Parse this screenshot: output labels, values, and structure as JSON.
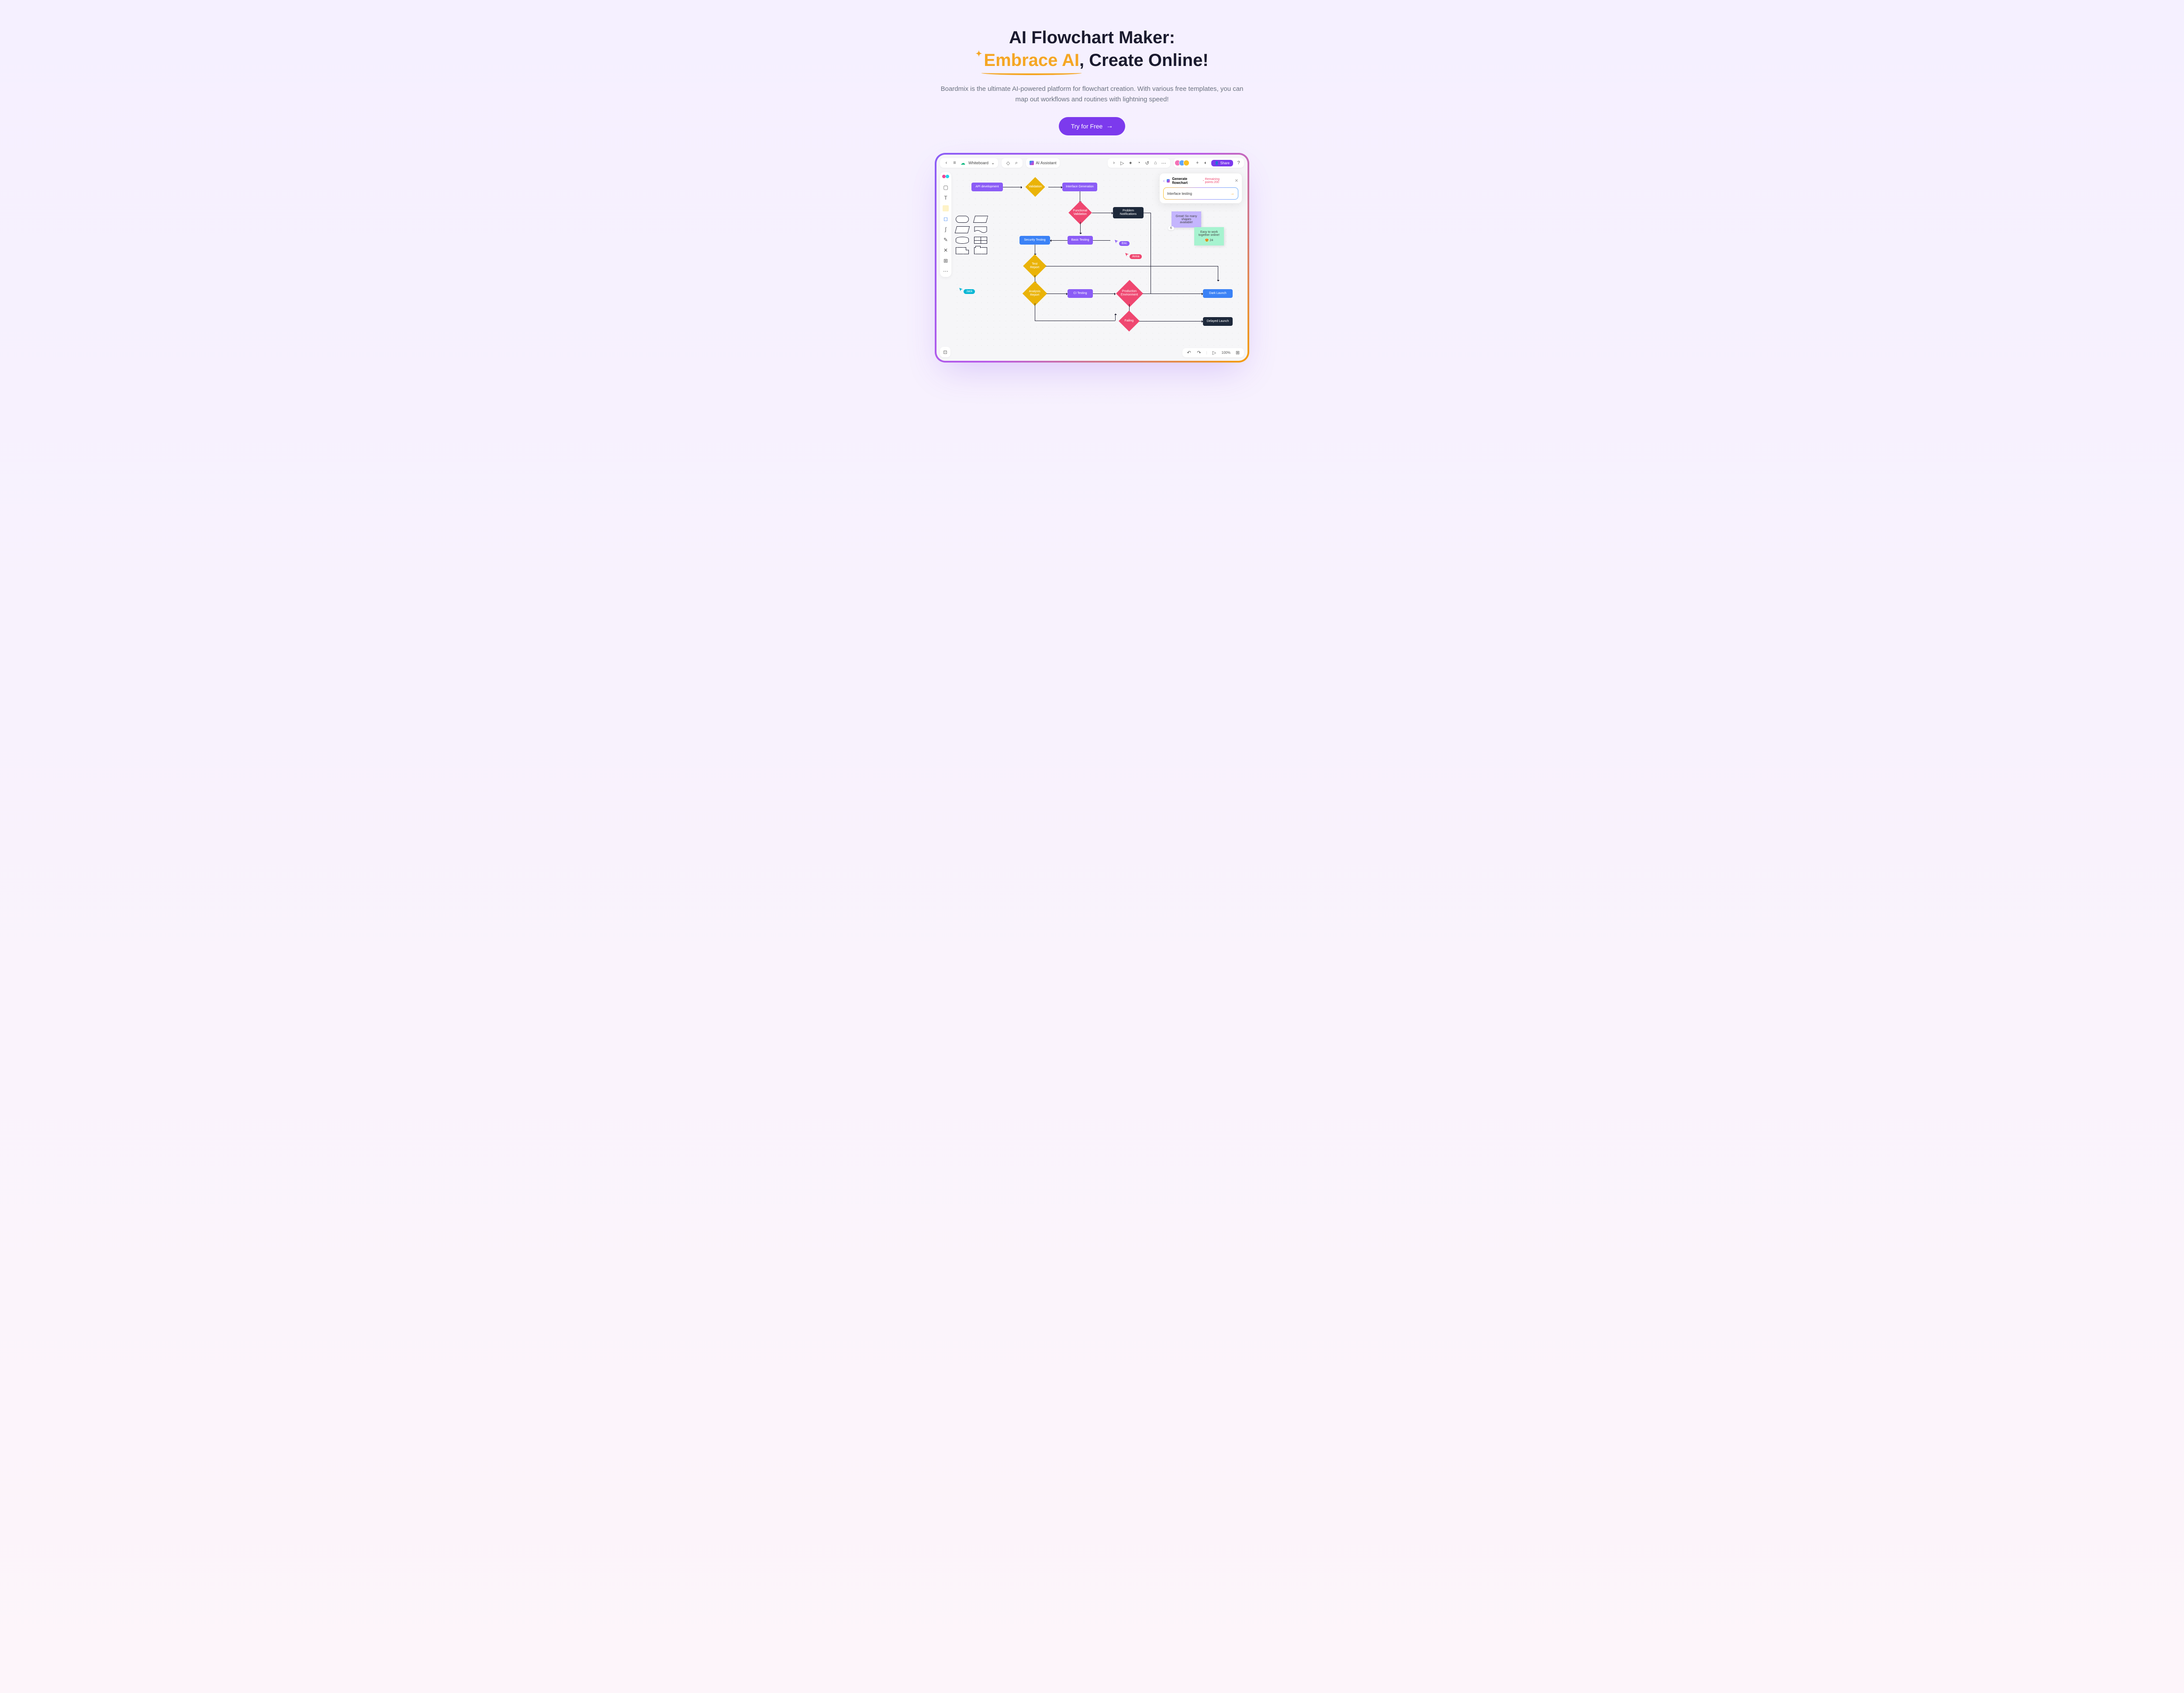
{
  "hero": {
    "title1": "AI Flowchart Maker:",
    "highlight": "Embrace AI",
    "title2": ", Create Online!",
    "subtitle": "Boardmix is the ultimate AI-powered platform for flowchart creation. With various free templates, you can map out workflows and routines with lightning speed!",
    "cta": "Try for Free"
  },
  "topbar": {
    "board_name": "Whiteboard",
    "ai_label": "AI Assistant",
    "share": "Share"
  },
  "ai_panel": {
    "title": "Generate flowchart",
    "points": "Remaining points:200",
    "input": "Interface testing"
  },
  "nodes": {
    "api_dev": "API development",
    "validation": "Validation",
    "iface_gen": "Interface Generation",
    "func_valid": "Functional Validation",
    "problem": "Problem Notifications",
    "sec_test": "Security Testing",
    "basic_test": "Basic Testing",
    "test_report": "Test Report",
    "analysis": "Analysis Report",
    "ci_test": "CI Testing",
    "prod_env": "Production Environment",
    "dark_launch": "Dark Launch",
    "failing": "Failing",
    "delayed": "Delayed Launch"
  },
  "stickies": {
    "note1": "Great! So many shapes available!",
    "note1_count": "6",
    "note2": "Easy to work together online!",
    "note2_react": "24"
  },
  "cursors": {
    "jack": "Jack",
    "eric": "Eric",
    "anna": "Anna"
  },
  "bottom": {
    "zoom": "100%"
  }
}
